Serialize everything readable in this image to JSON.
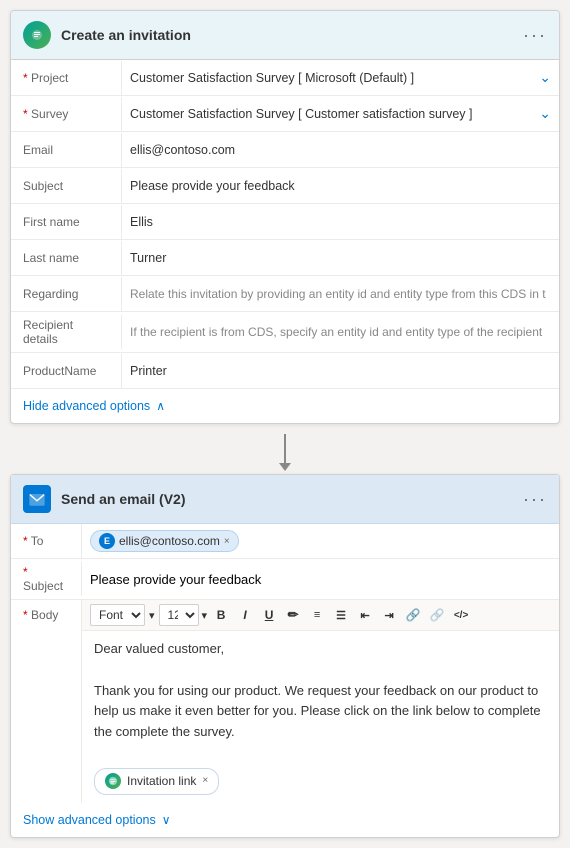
{
  "card1": {
    "header": {
      "title": "Create an invitation",
      "menu_label": "···",
      "icon_alt": "survey-icon"
    },
    "fields": [
      {
        "label": "Project",
        "required": true,
        "value": "Customer Satisfaction Survey [ Microsoft (Default) ]",
        "type": "dropdown",
        "placeholder": ""
      },
      {
        "label": "Survey",
        "required": true,
        "value": "Customer Satisfaction Survey [ Customer satisfaction survey ]",
        "type": "dropdown",
        "placeholder": ""
      },
      {
        "label": "Email",
        "required": false,
        "value": "ellis@contoso.com",
        "type": "text",
        "placeholder": ""
      },
      {
        "label": "Subject",
        "required": false,
        "value": "Please provide your feedback",
        "type": "text",
        "placeholder": ""
      },
      {
        "label": "First name",
        "required": false,
        "value": "Ellis",
        "type": "text",
        "placeholder": ""
      },
      {
        "label": "Last name",
        "required": false,
        "value": "Turner",
        "type": "text",
        "placeholder": ""
      },
      {
        "label": "Regarding",
        "required": false,
        "value": "Relate this invitation by providing an entity id and entity type from this CDS in t",
        "type": "text",
        "placeholder": ""
      },
      {
        "label": "Recipient details",
        "required": false,
        "value": "If the recipient is from CDS, specify an entity id and entity type of the recipient",
        "type": "text",
        "placeholder": ""
      },
      {
        "label": "ProductName",
        "required": false,
        "value": "Printer",
        "type": "text",
        "placeholder": ""
      }
    ],
    "hide_advanced": "Hide advanced options"
  },
  "connector": {
    "arrow": "↓"
  },
  "card2": {
    "header": {
      "title": "Send an email (V2)",
      "menu_label": "···",
      "icon_alt": "email-icon"
    },
    "to": {
      "label": "To",
      "required": true,
      "tag_text": "ellis@contoso.com",
      "tag_avatar_letter": "E"
    },
    "subject": {
      "label": "Subject",
      "required": true,
      "value": "Please provide your feedback"
    },
    "body": {
      "label": "Body",
      "required": true,
      "toolbar": {
        "font": "Font",
        "font_size": "12",
        "bold": "B",
        "italic": "I",
        "underline": "U",
        "color": "🖊",
        "ol": "ol",
        "ul": "ul",
        "indent_left": "←",
        "indent_right": "→",
        "link": "🔗",
        "unlink": "⛓",
        "code": "</>",
        "dropdown_arrow": "▾"
      },
      "content_line1": "Dear valued customer,",
      "content_line2": "Thank you for using our product. We request your feedback on our product to help us make it even better for you. Please click on the link below to complete the complete the survey.",
      "invitation_tag": "Invitation link",
      "invitation_tag_close": "×"
    },
    "show_advanced": "Show advanced options"
  }
}
